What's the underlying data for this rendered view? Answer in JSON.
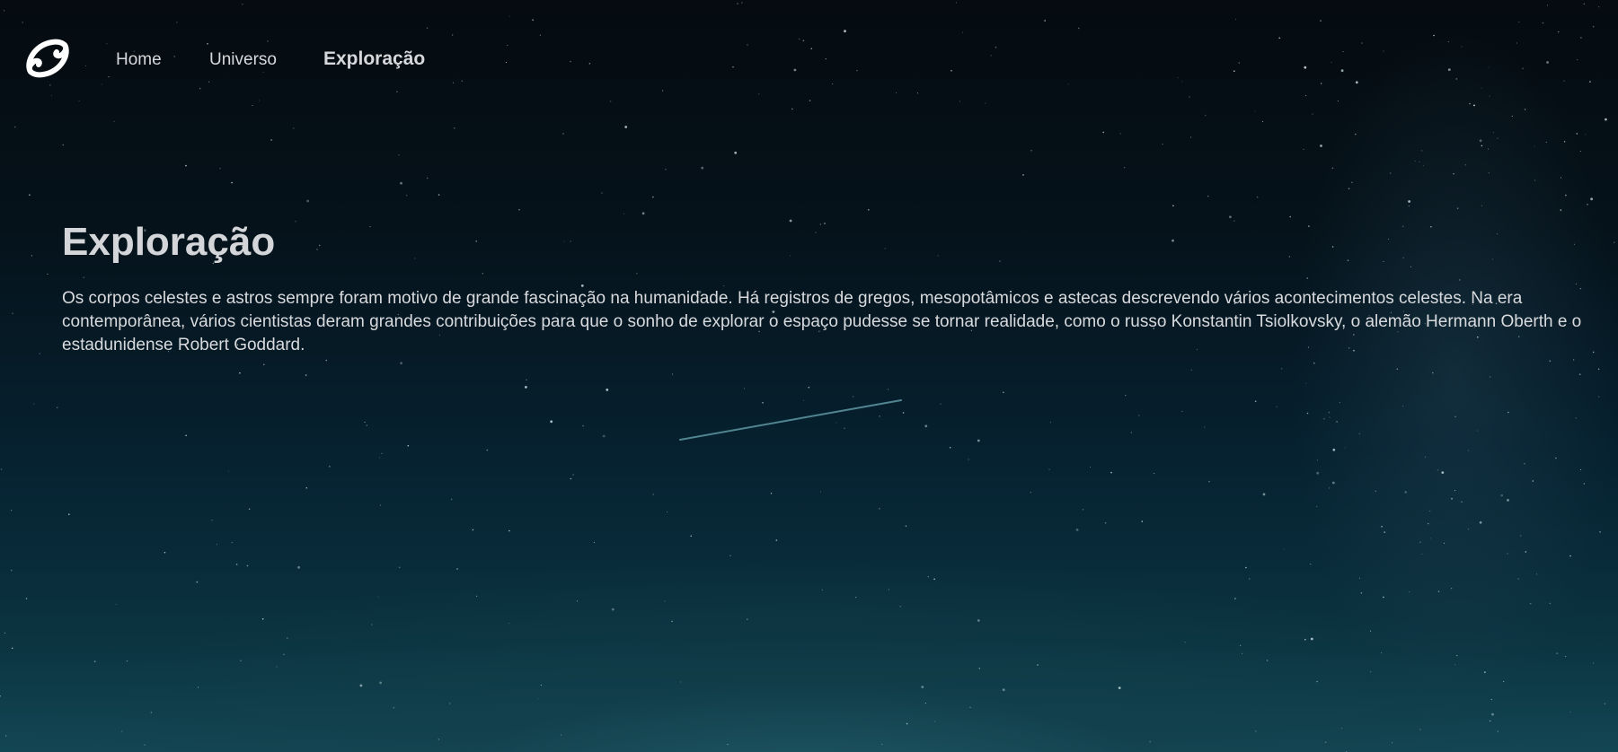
{
  "nav": {
    "logo_icon": "spiral-logo-icon",
    "links": [
      {
        "label": "Home"
      },
      {
        "label": "Universo"
      },
      {
        "label": "Exploração",
        "active": true
      }
    ]
  },
  "hero": {
    "title": "Exploração",
    "body": "Os corpos celestes e astros sempre foram motivo de grande fascinação na humanidade. Há registros de gregos, mesopotâmicos e astecas descrevendo vários acontecimentos celestes. Na era contemporânea, vários cientistas deram grandes contribuições para que o sonho de explorar o espaço pudesse se tornar realidade, como o russo Konstantin Tsiolkovsky, o alemão Hermann Oberth e o estadunidense Robert Goddard."
  },
  "colors": {
    "background_top": "#050b10",
    "background_bottom": "#134653",
    "text": "#d7d9dc"
  }
}
